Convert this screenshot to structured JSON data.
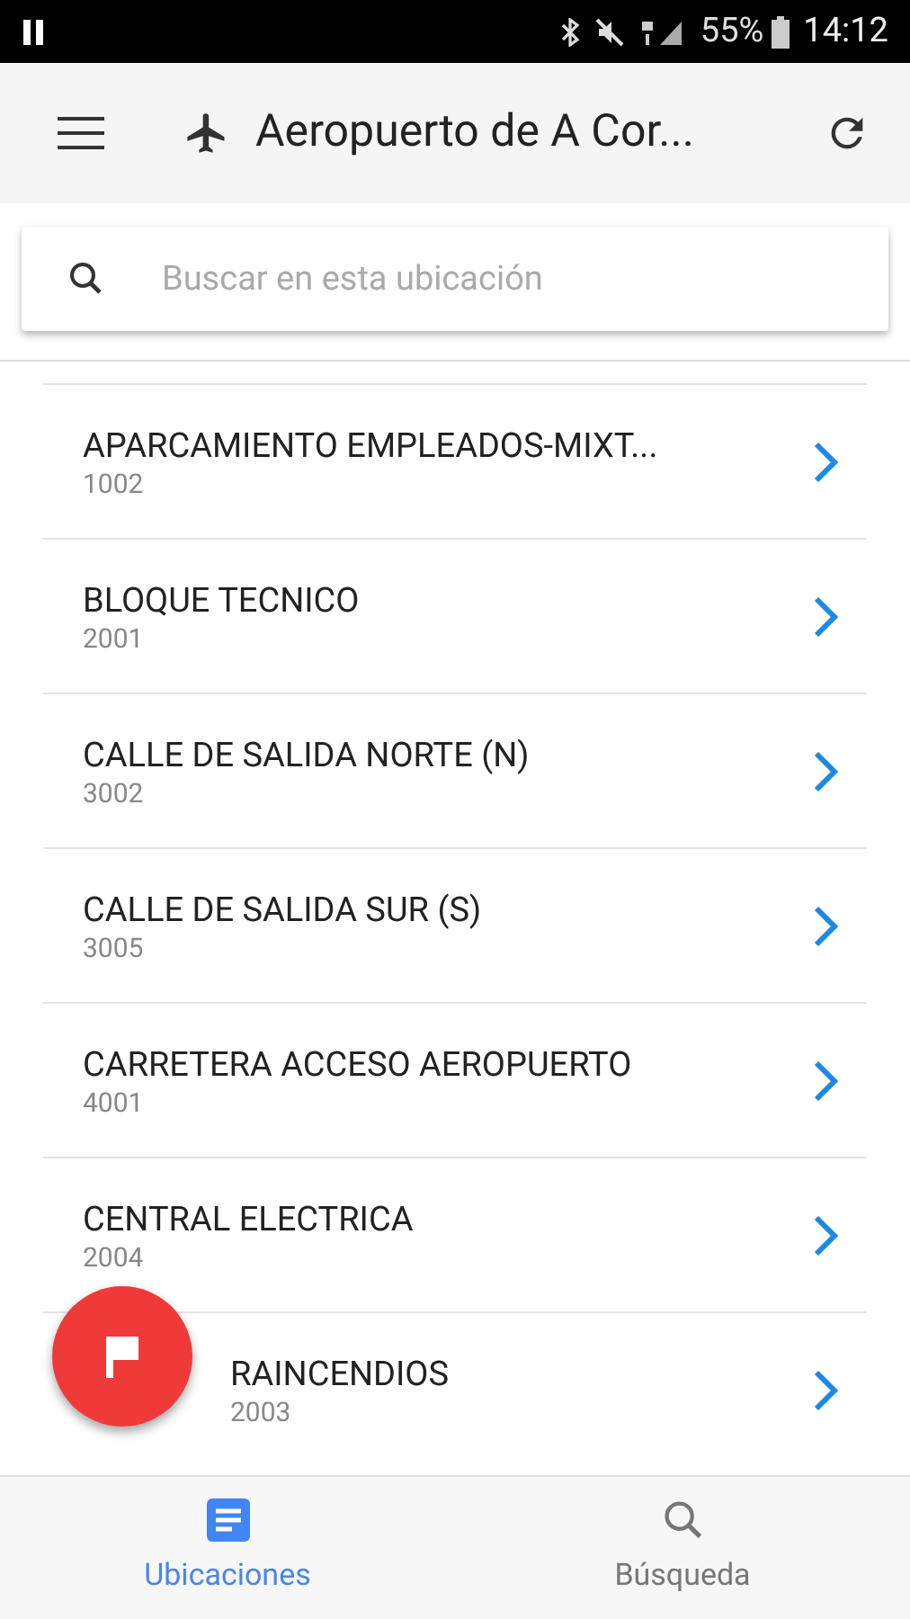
{
  "status_bar": {
    "battery": "55%",
    "time": "14:12"
  },
  "app_bar": {
    "title": "Aeropuerto de A Cor..."
  },
  "search": {
    "placeholder": "Buscar en esta ubicación"
  },
  "locations": [
    {
      "name": "APARCAMIENTO EMPLEADOS-MIXT...",
      "code": "1002",
      "partly_covered": false
    },
    {
      "name": "BLOQUE TECNICO",
      "code": "2001",
      "partly_covered": false
    },
    {
      "name": "CALLE DE SALIDA NORTE (N)",
      "code": "3002",
      "partly_covered": false
    },
    {
      "name": "CALLE DE SALIDA SUR (S)",
      "code": "3005",
      "partly_covered": false
    },
    {
      "name": "CARRETERA ACCESO AEROPUERTO",
      "code": "4001",
      "partly_covered": false
    },
    {
      "name": "CENTRAL ELECTRICA",
      "code": "2004",
      "partly_covered": false
    },
    {
      "name": "RAINCENDIOS",
      "code": "2003",
      "partly_covered": true
    }
  ],
  "bottom_nav": [
    {
      "label": "Ubicaciones",
      "kind": "list",
      "selected": true
    },
    {
      "label": "Búsqueda",
      "kind": "search",
      "selected": false
    }
  ]
}
